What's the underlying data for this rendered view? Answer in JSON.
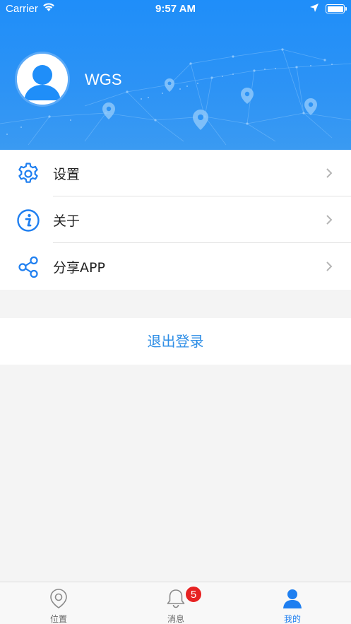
{
  "status_bar": {
    "carrier": "Carrier",
    "time": "9:57 AM"
  },
  "profile": {
    "username": "WGS"
  },
  "menu": {
    "items": [
      {
        "label": "设置",
        "icon": "gear-icon"
      },
      {
        "label": "关于",
        "icon": "info-icon"
      },
      {
        "label": "分享APP",
        "icon": "share-icon"
      }
    ]
  },
  "logout": {
    "label": "退出登录"
  },
  "tabbar": {
    "tabs": [
      {
        "label": "位置",
        "icon": "location-pin-icon"
      },
      {
        "label": "消息",
        "icon": "bell-icon",
        "badge": "5"
      },
      {
        "label": "我的",
        "icon": "user-icon",
        "active": true
      }
    ]
  },
  "colors": {
    "header_blue": "#1f8ef9",
    "accent_blue": "#2e8ee6",
    "badge_red": "#e62222"
  }
}
